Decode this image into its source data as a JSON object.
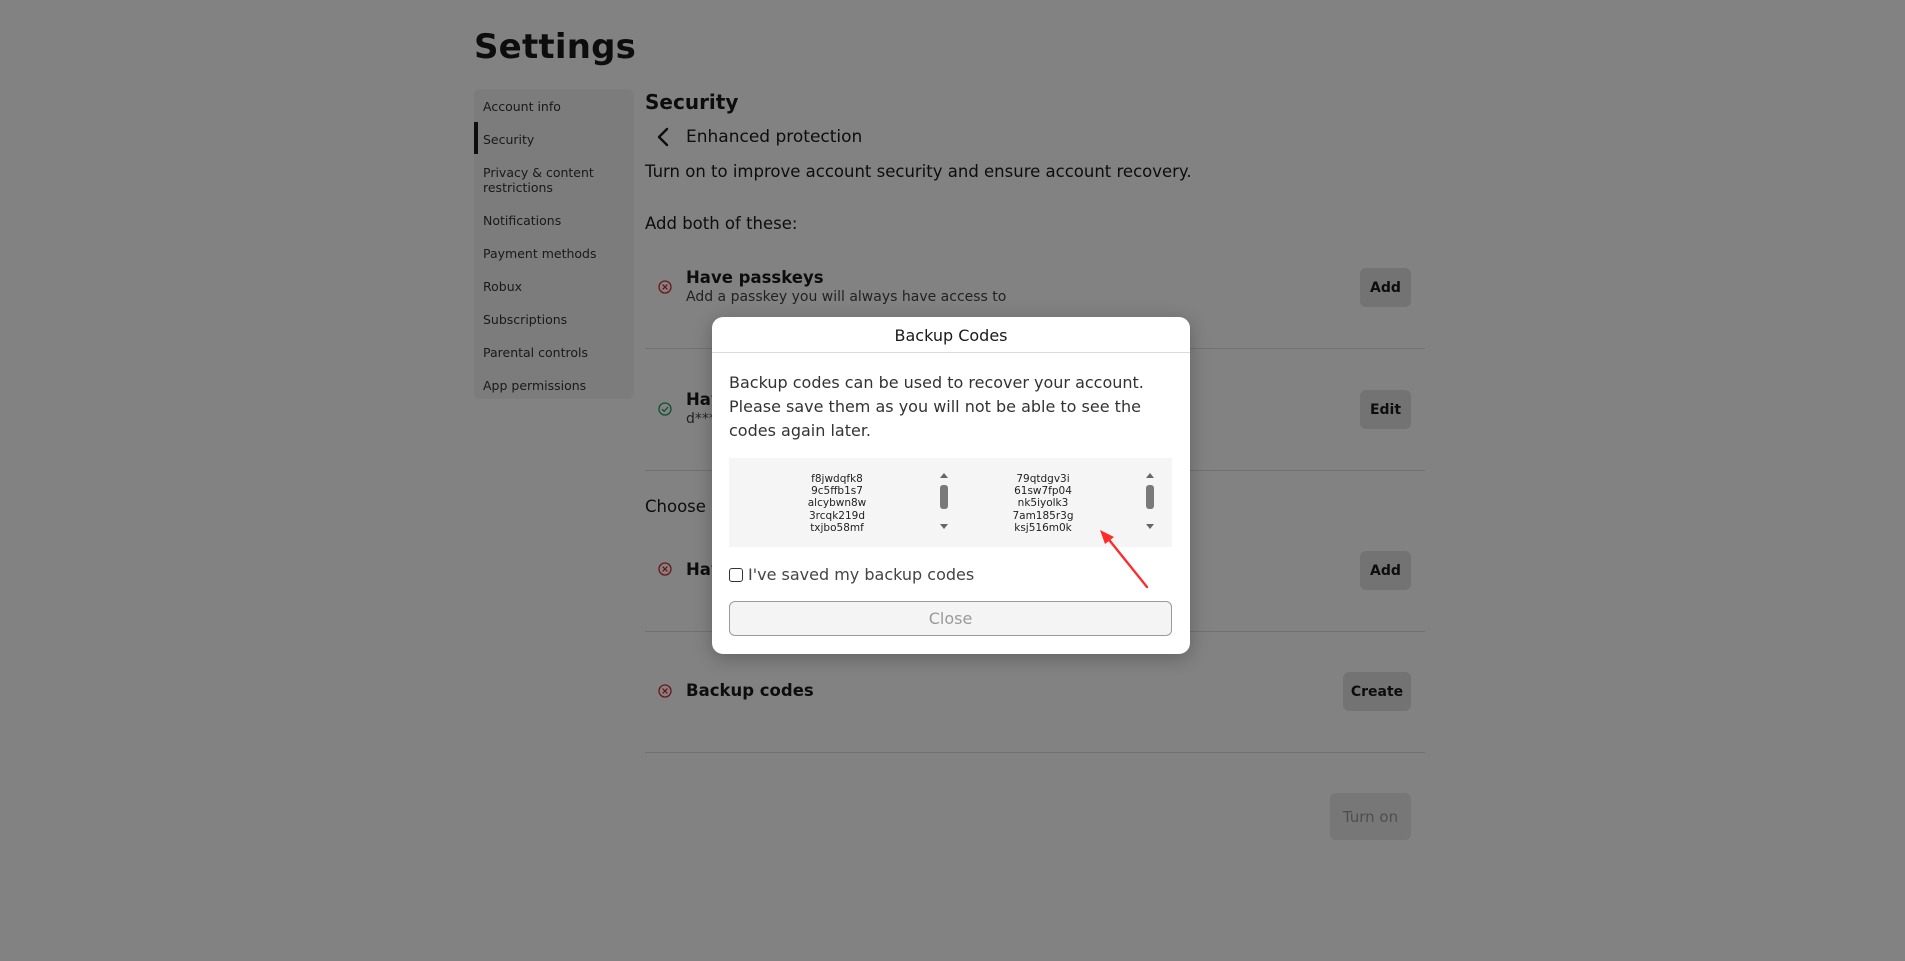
{
  "page": {
    "title": "Settings"
  },
  "sidebar": {
    "items": [
      {
        "label": "Account info"
      },
      {
        "label": "Security",
        "active": true
      },
      {
        "label": "Privacy & content restrictions"
      },
      {
        "label": "Notifications"
      },
      {
        "label": "Payment methods"
      },
      {
        "label": "Robux"
      },
      {
        "label": "Subscriptions"
      },
      {
        "label": "Parental controls"
      },
      {
        "label": "App permissions"
      }
    ]
  },
  "main": {
    "section_title": "Security",
    "subsection_title": "Enhanced protection",
    "description": "Turn on to improve account security and ensure account recovery.",
    "add_both_heading": "Add both of these:",
    "choose_heading": "Choose o",
    "rows": [
      {
        "title": "Have passkeys",
        "subtitle": "Add a passkey you will always have access to",
        "status": "missing",
        "button": "Add"
      },
      {
        "title": "Hav",
        "subtitle": "d***",
        "status": "done",
        "button": "Edit"
      },
      {
        "title": "Hav",
        "subtitle": "",
        "status": "missing",
        "button": "Add"
      },
      {
        "title": "Backup codes",
        "subtitle": "",
        "status": "missing",
        "button": "Create"
      }
    ],
    "turn_on_label": "Turn on"
  },
  "modal": {
    "title": "Backup Codes",
    "body": "Backup codes can be used to recover your account. Please save them as you will not be able to see the codes again later.",
    "codes_left": [
      "f8jwdqfk8",
      "9c5ffb1s7",
      "alcybwn8w",
      "3rcqk219d",
      "txjbo58mf"
    ],
    "codes_right": [
      "79qtdgv3i",
      "61sw7fp04",
      "nk5iyolk3",
      "7am185r3g",
      "ksj516m0k"
    ],
    "checkbox_label": "I've saved my backup codes",
    "close_label": "Close"
  },
  "colors": {
    "overlay": "#000000",
    "error_icon": "#d9262f",
    "success_icon": "#1f9d55",
    "annotation_arrow": "#ff2b2b"
  },
  "icons": {
    "back": "chevron-left-icon",
    "missing": "x-circle-icon",
    "done": "check-circle-icon"
  }
}
